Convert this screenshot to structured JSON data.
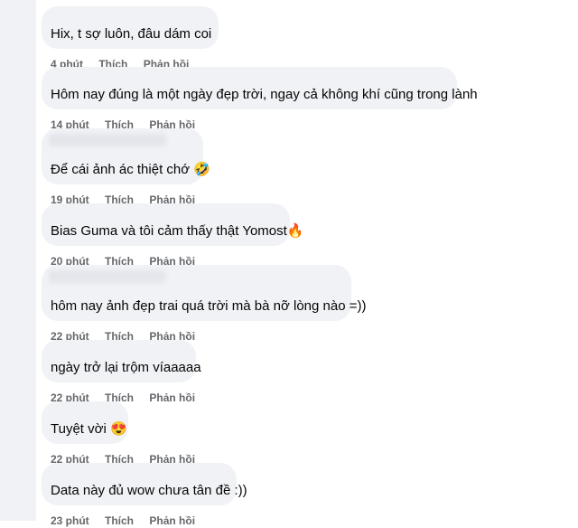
{
  "comments": [
    {
      "text": "Hix, t sợ    luôn, đâu dám coi",
      "time": "4 phút",
      "like": "Thích",
      "reply": "Phản hồi"
    },
    {
      "text": "Hôm nay đúng là một ngày đẹp trời, ngay cả không khí cũng trong lành",
      "time": "14 phút",
      "like": "Thích",
      "reply": "Phản hồi"
    },
    {
      "text": "Để cái ảnh ác thiệt chớ 🤣",
      "time": "19 phút",
      "like": "Thích",
      "reply": "Phản hồi"
    },
    {
      "text": "Bias Guma và tôi cảm thấy thật Yomost🔥",
      "time": "20 phút",
      "like": "Thích",
      "reply": "Phản hồi"
    },
    {
      "text": "hôm nay ảnh đẹp trai quá trời mà bà nỡ lòng nào =))",
      "time": "22 phút",
      "like": "Thích",
      "reply": "Phản hồi"
    },
    {
      "text": "ngày trở lại trộm víaaaaa",
      "time": "22 phút",
      "like": "Thích",
      "reply": "Phản hồi"
    },
    {
      "text": "Tuyệt vời 😍",
      "time": "22 phút",
      "like": "Thích",
      "reply": "Phản hồi"
    },
    {
      "text": "Data này đủ wow chưa tân đề :))",
      "time": "23 phút",
      "like": "Thích",
      "reply": "Phản hồi"
    }
  ]
}
